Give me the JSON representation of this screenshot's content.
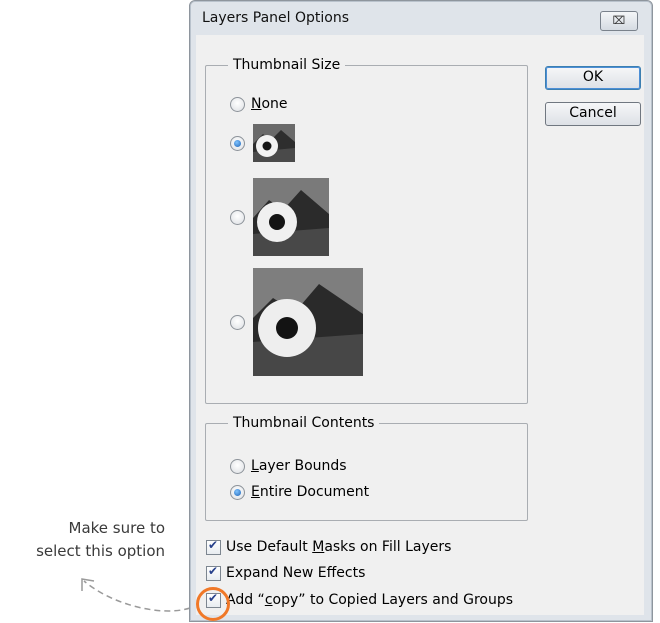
{
  "annotation": {
    "line1": "Make sure to",
    "line2": "select this option",
    "highlight_color": "#f07828"
  },
  "dialog": {
    "title": "Layers Panel Options",
    "close_label": "⌧",
    "buttons": {
      "ok": "OK",
      "cancel": "Cancel"
    },
    "thumbnail_size": {
      "legend": "Thumbnail Size",
      "options": [
        {
          "label": "None",
          "checked": false
        },
        {
          "label": "",
          "size": "small",
          "checked": true
        },
        {
          "label": "",
          "size": "medium",
          "checked": false
        },
        {
          "label": "",
          "size": "large",
          "checked": false
        }
      ]
    },
    "thumbnail_contents": {
      "legend": "Thumbnail Contents",
      "layer_bounds": "Layer Bounds",
      "entire_document": "Entire Document",
      "selected": "Entire Document"
    },
    "checkboxes": {
      "default_masks": {
        "label": "Use Default Masks on Fill Layers",
        "checked": true
      },
      "expand_effects": {
        "label": "Expand New Effects",
        "checked": true
      },
      "add_copy": {
        "label": "Add “copy” to Copied Layers and Groups",
        "checked": true
      }
    }
  }
}
